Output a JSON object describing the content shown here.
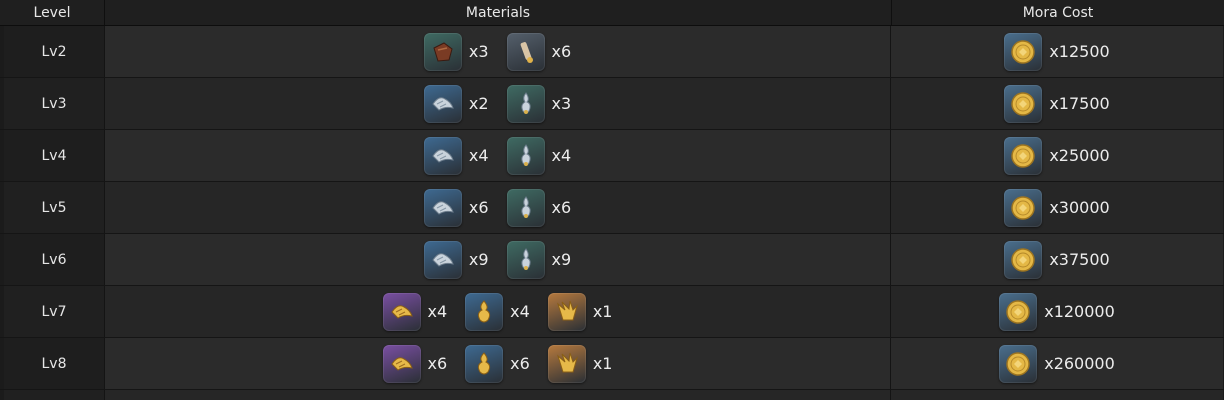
{
  "headers": {
    "level": "Level",
    "materials": "Materials",
    "mora": "Mora Cost"
  },
  "icon_colors": {
    "teal": "#3f6b63",
    "slate": "#55606c",
    "blue": "#3e6a92",
    "purple": "#7a4fa3",
    "orange": "#b77a3e",
    "mora": "#4a6f8e"
  },
  "rows": [
    {
      "level": "Lv2",
      "items": [
        {
          "icon": "leather-brown-icon",
          "bg": "teal",
          "qty": "x3"
        },
        {
          "icon": "slate-scroll-icon",
          "bg": "slate",
          "qty": "x6"
        }
      ],
      "mora_qty": "x12500"
    },
    {
      "level": "Lv3",
      "items": [
        {
          "icon": "silver-claw-icon",
          "bg": "blue",
          "qty": "x2"
        },
        {
          "icon": "silver-flame-icon",
          "bg": "teal",
          "qty": "x3"
        }
      ],
      "mora_qty": "x17500"
    },
    {
      "level": "Lv4",
      "items": [
        {
          "icon": "silver-claw-icon",
          "bg": "blue",
          "qty": "x4"
        },
        {
          "icon": "silver-flame-icon",
          "bg": "teal",
          "qty": "x4"
        }
      ],
      "mora_qty": "x25000"
    },
    {
      "level": "Lv5",
      "items": [
        {
          "icon": "silver-claw-icon",
          "bg": "blue",
          "qty": "x6"
        },
        {
          "icon": "silver-flame-icon",
          "bg": "teal",
          "qty": "x6"
        }
      ],
      "mora_qty": "x30000"
    },
    {
      "level": "Lv6",
      "items": [
        {
          "icon": "silver-claw-icon",
          "bg": "blue",
          "qty": "x9"
        },
        {
          "icon": "silver-flame-icon",
          "bg": "teal",
          "qty": "x9"
        }
      ],
      "mora_qty": "x37500"
    },
    {
      "level": "Lv7",
      "items": [
        {
          "icon": "gold-claw-icon",
          "bg": "purple",
          "qty": "x4"
        },
        {
          "icon": "gold-flame-icon",
          "bg": "blue",
          "qty": "x4"
        },
        {
          "icon": "gold-crown-icon",
          "bg": "orange",
          "qty": "x1"
        }
      ],
      "mora_qty": "x120000"
    },
    {
      "level": "Lv8",
      "items": [
        {
          "icon": "gold-claw-icon",
          "bg": "purple",
          "qty": "x6"
        },
        {
          "icon": "gold-flame-icon",
          "bg": "blue",
          "qty": "x6"
        },
        {
          "icon": "gold-crown-icon",
          "bg": "orange",
          "qty": "x1"
        }
      ],
      "mora_qty": "x260000"
    }
  ]
}
